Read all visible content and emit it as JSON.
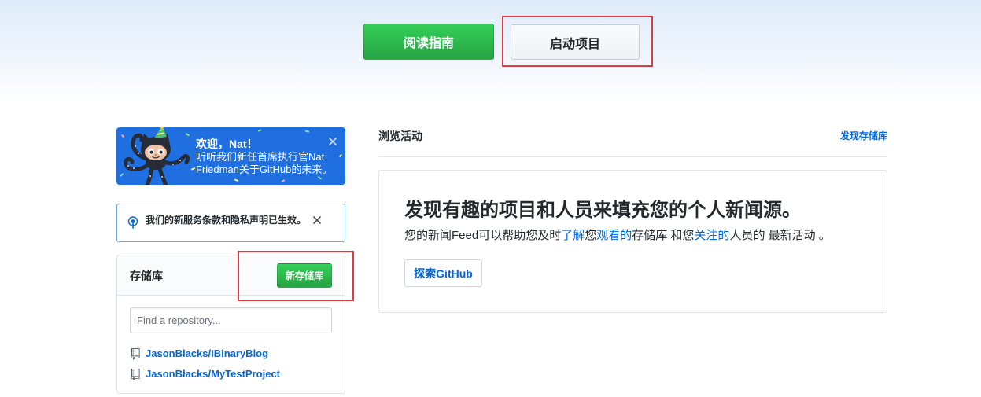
{
  "top_actions": {
    "read_guide_label": "阅读指南",
    "start_project_label": "启动项目"
  },
  "welcome": {
    "title": "欢迎，Nat！",
    "body_line1": "听听我们新任首席执行官Nat",
    "body_line2": "Friedman关于GitHub的未来。"
  },
  "notice": {
    "text": "我们的新服务条款和隐私声明已生效。"
  },
  "repositories": {
    "title": "存储库",
    "new_button_label": "新存储库",
    "search_placeholder": "Find a repository...",
    "items": [
      {
        "name": "JasonBlacks/IBinaryBlog"
      },
      {
        "name": "JasonBlacks/MyTestProject"
      }
    ]
  },
  "feed": {
    "title": "浏览活动",
    "discover_link": "发现存储库",
    "card": {
      "heading": "发现有趣的项目和人员来填充您的个人新闻源。",
      "description": {
        "part1": "您的新闻Feed可以帮助您及时",
        "link1": "了解",
        "part2": "您",
        "link2": "观看的",
        "part3": "存储库 和您",
        "link3": "关注的",
        "part4": "人员的 最新活动 。"
      },
      "explore_button_label": "探索GitHub"
    }
  },
  "icons": {
    "welcome_mascot": "octocat-party-icon",
    "welcome_close": "close-icon",
    "notice_icon": "broadcast-icon",
    "notice_close": "close-icon",
    "repo_item_icon": "repo-icon"
  },
  "colors": {
    "accent_green": "#28a745",
    "link_blue": "#0366d6",
    "welcome_bg": "#1f6fe0",
    "highlight_red": "#e2393f",
    "text_dark": "#24292e",
    "notice_border": "#6aa5e8"
  }
}
